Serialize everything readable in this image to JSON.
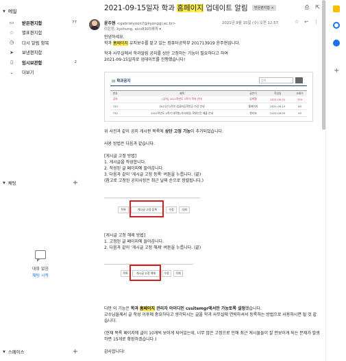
{
  "sidebar": {
    "mail_label": "메일",
    "items": [
      {
        "label": "받은편지함",
        "count": "77",
        "bold": true
      },
      {
        "label": "별표편지함",
        "count": "",
        "bold": false
      },
      {
        "label": "다시 알림 항목",
        "count": "",
        "bold": false
      },
      {
        "label": "보낸편지함",
        "count": "",
        "bold": false
      },
      {
        "label": "임시보관함",
        "count": "2",
        "bold": true
      },
      {
        "label": "더보기",
        "count": "",
        "bold": false
      }
    ],
    "chat_label": "채팅",
    "chat_empty": "대화 없음",
    "chat_start": "채팅 시작",
    "spaces_label": "스페이스"
  },
  "email": {
    "subject_pre": "2021-09-15일자 학과 ",
    "subject_hl": "홈페이지",
    "subject_post": " 업데이트 알림",
    "chip": "받은편지함 ×",
    "sender_name": "윤주현",
    "sender_addr": "<gabrielyoon7@kyonggi.ac.kr>",
    "recipients": "이은정, kychung, aics8305에게",
    "datetime": "2021년 9월 15일 (수) 오전 12:57",
    "greeting": "안녕하세요.",
    "intro_pre": "학과 ",
    "intro_hl": "홈페이지",
    "intro_post": " 유지보수를 맡고 있는 컴퓨터공학부 201713919 윤주현입니다.",
    "para2_l1": "학과 사무실에서 학과알림 공지를 상단 고정하는 기능이 필요하다고 하여",
    "para2_l2": "2021-09-15일자로 업데이트를 진행했습니다!",
    "board": {
      "title": "학과공지",
      "search": "검색",
      "headers": [
        "번호",
        "제목",
        "글쓴이",
        "작성일",
        "조회수"
      ],
      "rows": [
        [
          "공지",
          "[공지] 2021학년도 2학기 학과 안내",
          "김희철",
          "2021-09-01",
          "353"
        ],
        [
          "733",
          "2021년 2학기 컴퓨터공학전공 수강 안내",
          "홈페이지",
          "2021-09-13",
          "85"
        ],
        [
          "732",
          "2021학년도 2학기 대학원(석사과정) 학위논문 제출 안내",
          "관리자",
          "2021-09-03",
          "93"
        ]
      ]
    },
    "line_a_pre": "위 사진과 같이 공지 게시판 목록에 ",
    "line_a_bold": "상단 고정 기능",
    "line_a_post": "이 추가되었습니다.",
    "usage": "사용 방법은 다음과 같습니다.",
    "pin_title": "[게시글 고정 방법]",
    "pin_1": "1. 게시글을 작성합니다.",
    "pin_2": "2. 작성된 글 페이지에 들어갑니다.",
    "pin_3": "3. 다음과 같이 '게시글 고정 등록' 버튼을 누릅니다. (끝)",
    "pin_4": "(참고로 고정된 공지사항은 최근 날짜 순으로 정렬됩니다.)",
    "btns1": [
      "목록",
      "게시글 고정 등록",
      "수정",
      "삭제"
    ],
    "unpin_title": "[게시글 고정 해제 방법]",
    "unpin_1": "1. 고정된 글 페이지에 들어갑니다.",
    "unpin_2": "2. 다음과 같이 '게시글 고정 해제' 버튼을 누릅니다. (끝)",
    "btns2": [
      "목록",
      "게시글 고정 해제",
      "수정",
      "삭제"
    ],
    "note_pre": "다만 이 기능은 ",
    "note_b1": "학과 ",
    "note_hl": "홈페이지",
    "note_b2": " 관리자 아이디인 cssitemgr에서만 가능토록 설정",
    "note_post": "했습니다.",
    "note_l2": "교수님들께서 글 작성 이후에 중요하다고 생각되시는 글을 학과 사무실에 연락하셔서 등록하는 방법으로 사용하시면 될 것 같습니다.",
    "note_l3": "(현재 목록 페이지에 글이 10개씩 보이게 되어있는데, 너무 많은 고정으로 인해 최근 게시물들이 잘 안보이게 되는 문제가 발생하면 15개로 확장하겠습니다.)",
    "thanks": "감사합니다!"
  }
}
